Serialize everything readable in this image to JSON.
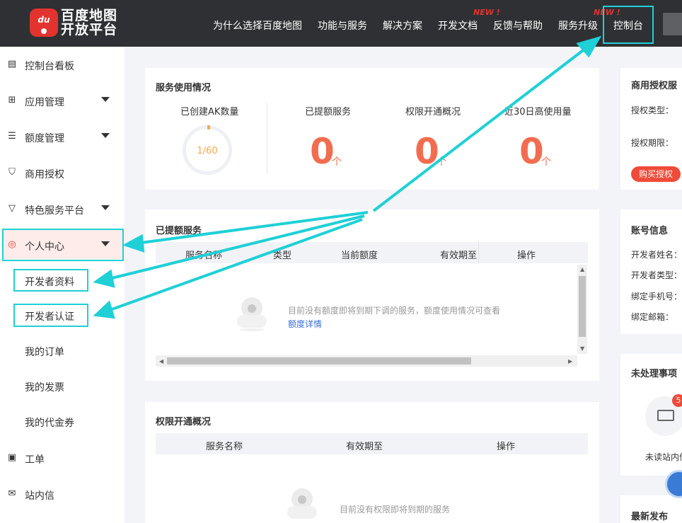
{
  "header": {
    "logo_line1": "百度地图",
    "logo_line2": "开放平台",
    "logo_icon_text": "du",
    "nav": [
      "为什么选择百度地图",
      "功能与服务",
      "解决方案",
      "开发文档",
      "反馈与帮助",
      "服务升级",
      "控制台"
    ],
    "new_tag": "NEW !"
  },
  "sidebar": {
    "items": [
      {
        "label": "控制台看板",
        "icon": "dashboard-icon"
      },
      {
        "label": "应用管理",
        "icon": "grid-icon"
      },
      {
        "label": "额度管理",
        "icon": "sliders-icon"
      },
      {
        "label": "商用授权",
        "icon": "shield-icon"
      },
      {
        "label": "特色服务平台",
        "icon": "badge-icon"
      },
      {
        "label": "个人中心",
        "icon": "user-icon"
      }
    ],
    "sub_items": [
      "开发者资料",
      "开发者认证",
      "我的订单",
      "我的发票",
      "我的代金券"
    ],
    "bottom_items": [
      {
        "label": "工单",
        "icon": "clipboard-icon"
      },
      {
        "label": "站内信",
        "icon": "mail-icon"
      }
    ]
  },
  "usage": {
    "title": "服务使用情况",
    "stats": [
      {
        "label": "已创建AK数量",
        "value": "1/60"
      },
      {
        "label": "已提额服务",
        "value": "0",
        "unit": "个"
      },
      {
        "label": "权限开通概况",
        "value": "0",
        "unit": "个"
      },
      {
        "label": "近30日高使用量",
        "value": "0",
        "unit": "个"
      }
    ]
  },
  "quota": {
    "title": "已提额服务",
    "columns": [
      "服务名称",
      "类型",
      "当前额度",
      "有效期至",
      "操作"
    ],
    "empty_text": "目前没有额度即将到期下调的服务，额度使用情况可查看",
    "empty_link": "额度详情"
  },
  "perm": {
    "title": "权限开通概况",
    "columns": [
      "服务名称",
      "有效期至",
      "操作"
    ],
    "empty_text": "目前没有权限即将到期的服务"
  },
  "right": {
    "license_title": "商用授权服",
    "license_type_label": "授权类型：",
    "license_period_label": "授权期限：",
    "buy_button": "购买授权",
    "account_title": "账号信息",
    "account_fields": [
      "开发者姓名：",
      "开发者类型：",
      "绑定手机号：",
      "绑定邮箱："
    ],
    "todo_title": "未处理事项",
    "unread_badge": "5",
    "unread_label": "未读站内信",
    "latest_title": "最新发布"
  },
  "colors": {
    "header_bg": "#2f3033",
    "accent_red": "#e3332f",
    "highlight_cyan": "#1fd0d6",
    "stat_orange": "#f26d4f"
  }
}
